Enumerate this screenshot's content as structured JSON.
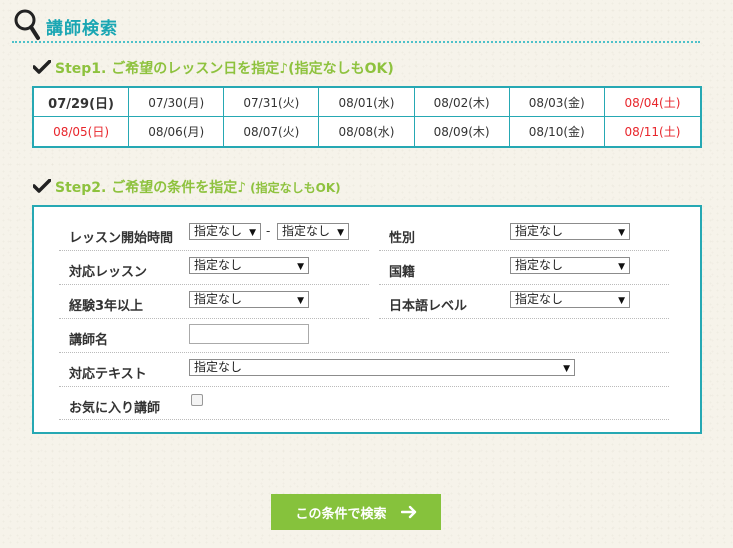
{
  "header": {
    "title": "講師検索",
    "icon": "magnifier-icon"
  },
  "step1": {
    "title": "Step1. ご希望のレッスン日を指定♪",
    "note": "(指定なしもOK)"
  },
  "calendar": {
    "row1": [
      {
        "label": "07/29(日)",
        "selected": true,
        "red": false
      },
      {
        "label": "07/30(月)",
        "selected": false,
        "red": false
      },
      {
        "label": "07/31(火)",
        "selected": false,
        "red": false
      },
      {
        "label": "08/01(水)",
        "selected": false,
        "red": false
      },
      {
        "label": "08/02(木)",
        "selected": false,
        "red": false
      },
      {
        "label": "08/03(金)",
        "selected": false,
        "red": false
      },
      {
        "label": "08/04(土)",
        "selected": false,
        "red": true
      }
    ],
    "row2": [
      {
        "label": "08/05(日)",
        "selected": false,
        "red": true
      },
      {
        "label": "08/06(月)",
        "selected": false,
        "red": false
      },
      {
        "label": "08/07(火)",
        "selected": false,
        "red": false
      },
      {
        "label": "08/08(水)",
        "selected": false,
        "red": false
      },
      {
        "label": "08/09(木)",
        "selected": false,
        "red": false
      },
      {
        "label": "08/10(金)",
        "selected": false,
        "red": false
      },
      {
        "label": "08/11(土)",
        "selected": false,
        "red": true
      }
    ]
  },
  "step2": {
    "title": "Step2. ご希望の条件を指定♪",
    "note": "(指定なしもOK)"
  },
  "conditions": {
    "lesson_start": {
      "label": "レッスン開始時間",
      "from": "指定なし",
      "to": "指定なし",
      "sep": "-"
    },
    "gender": {
      "label": "性別",
      "value": "指定なし"
    },
    "lesson_type": {
      "label": "対応レッスン",
      "value": "指定なし"
    },
    "nationality": {
      "label": "国籍",
      "value": "指定なし"
    },
    "experience": {
      "label": "経験3年以上",
      "value": "指定なし"
    },
    "japanese_level": {
      "label": "日本語レベル",
      "value": "指定なし"
    },
    "teacher_name": {
      "label": "講師名",
      "value": ""
    },
    "textbook": {
      "label": "対応テキスト",
      "value": "指定なし"
    },
    "favorite": {
      "label": "お気に入り講師",
      "checked": false
    }
  },
  "search_button": {
    "label": "この条件で検索"
  },
  "colors": {
    "accent": "#26a8b3",
    "green": "#86c23c",
    "red": "#e8262c"
  }
}
